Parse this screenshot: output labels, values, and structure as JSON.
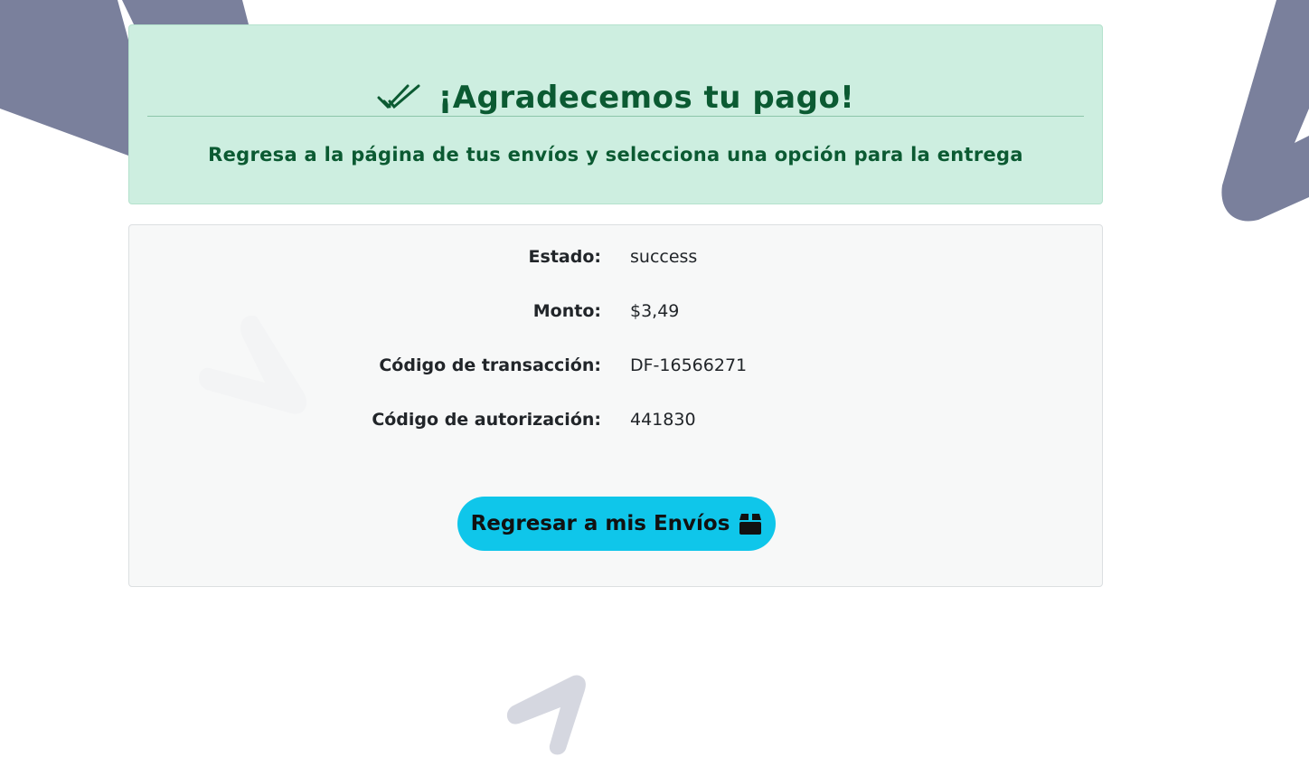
{
  "alert": {
    "icon": "double-check-icon",
    "title": "¡Agradecemos tu pago!",
    "subtitle": "Regresa a la página de tus envíos y selecciona una opción para la entrega",
    "colors": {
      "background": "#cdeee0",
      "text": "#0b5a32"
    }
  },
  "details": {
    "rows": [
      {
        "label": "Estado:",
        "value": "success"
      },
      {
        "label": "Monto:",
        "value": "$3,49"
      },
      {
        "label": "Código de transacción:",
        "value": "DF-16566271"
      },
      {
        "label": "Código de autorización:",
        "value": "441830"
      }
    ]
  },
  "button": {
    "label": "Regresar a mis Envíos",
    "icon": "box-icon",
    "color": "#0fc6ea"
  },
  "background": {
    "shape_color": "#7a7f9c",
    "faint_shape_color": "#e8e9ee"
  }
}
